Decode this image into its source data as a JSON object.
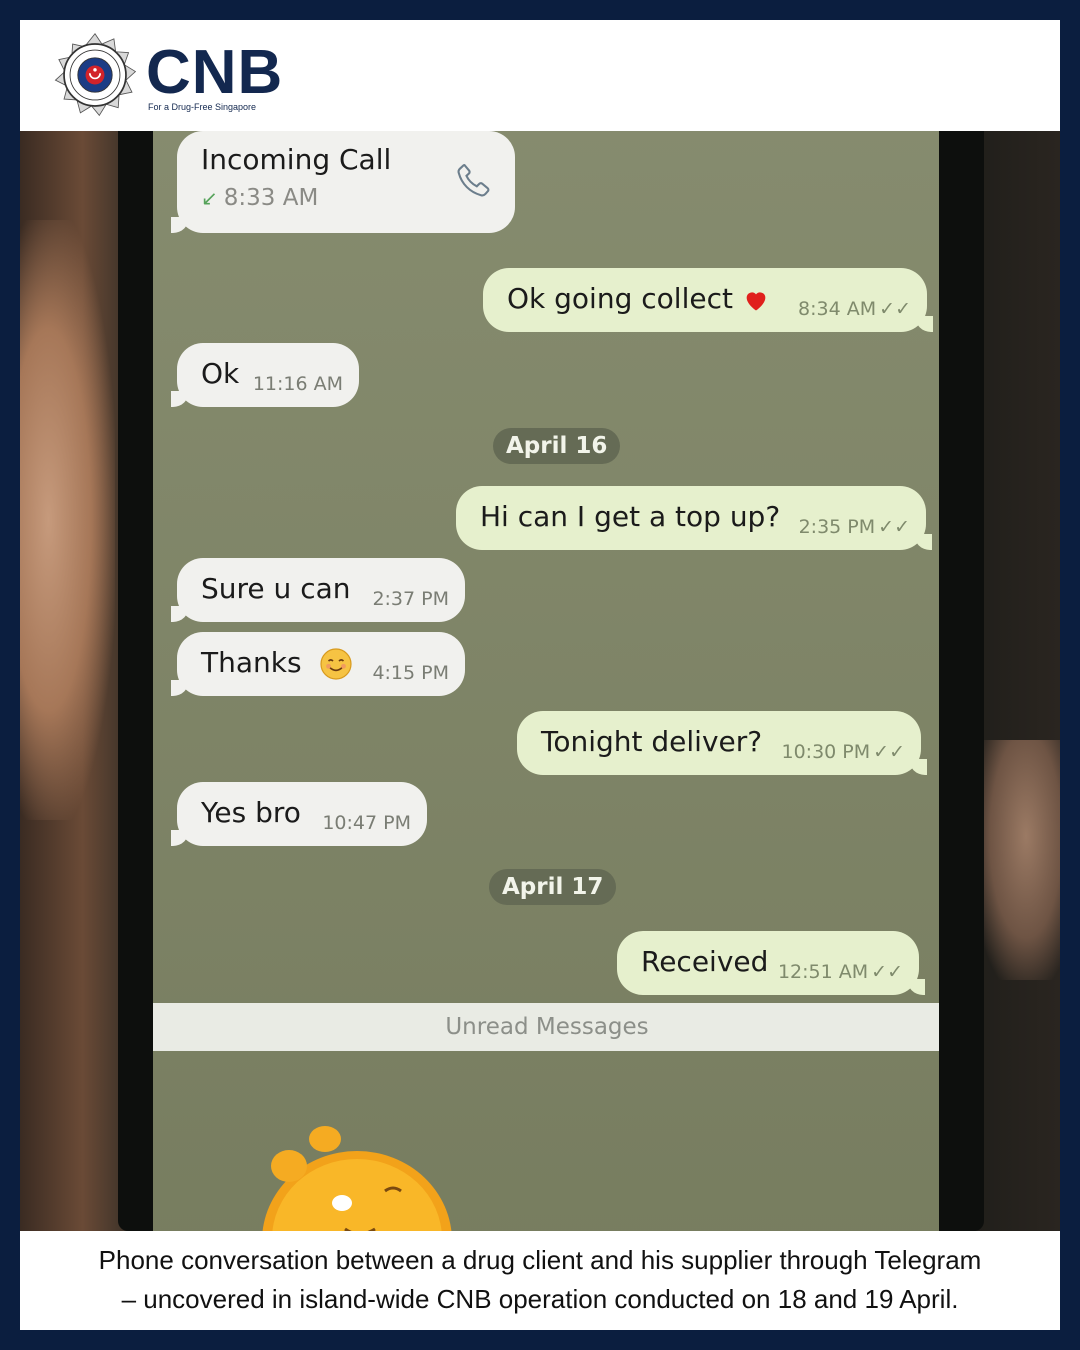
{
  "header": {
    "brand": "CNB",
    "tagline": "For a Drug-Free Singapore"
  },
  "chat": {
    "incoming_call": {
      "label": "Incoming Call",
      "time": "8:33 AM",
      "icon": "phone-icon"
    },
    "messages": [
      {
        "direction": "out",
        "text": "Ok going collect",
        "emoji": "red-heart",
        "time": "8:34 AM",
        "read": true
      },
      {
        "direction": "in",
        "text": "Ok",
        "time": "11:16 AM"
      },
      {
        "direction": "date",
        "text": "April 16"
      },
      {
        "direction": "out",
        "text": "Hi can I get a top up?",
        "time": "2:35 PM",
        "read": true
      },
      {
        "direction": "in",
        "text": "Sure u can",
        "time": "2:37 PM"
      },
      {
        "direction": "in",
        "text": "Thanks",
        "emoji": "smiling-face",
        "time": "4:15 PM"
      },
      {
        "direction": "out",
        "text": "Tonight deliver?",
        "time": "10:30 PM",
        "read": true
      },
      {
        "direction": "in",
        "text": "Yes bro",
        "time": "10:47 PM"
      },
      {
        "direction": "date",
        "text": "April 17"
      },
      {
        "direction": "out",
        "text": "Received",
        "time": "12:51 AM",
        "read": true
      }
    ],
    "unread_label": "Unread Messages",
    "read_ticks": "✓✓"
  },
  "caption": {
    "line1": "Phone conversation between a drug client and his supplier through Telegram",
    "line2": "– uncovered in island-wide CNB operation conducted on 18 and 19 April."
  },
  "colors": {
    "border": "#0b1e3f",
    "brand": "#13284f",
    "chat_background": "#7e8465",
    "outgoing_bubble": "#e6f0cd",
    "incoming_bubble": "#f1f1ee"
  }
}
